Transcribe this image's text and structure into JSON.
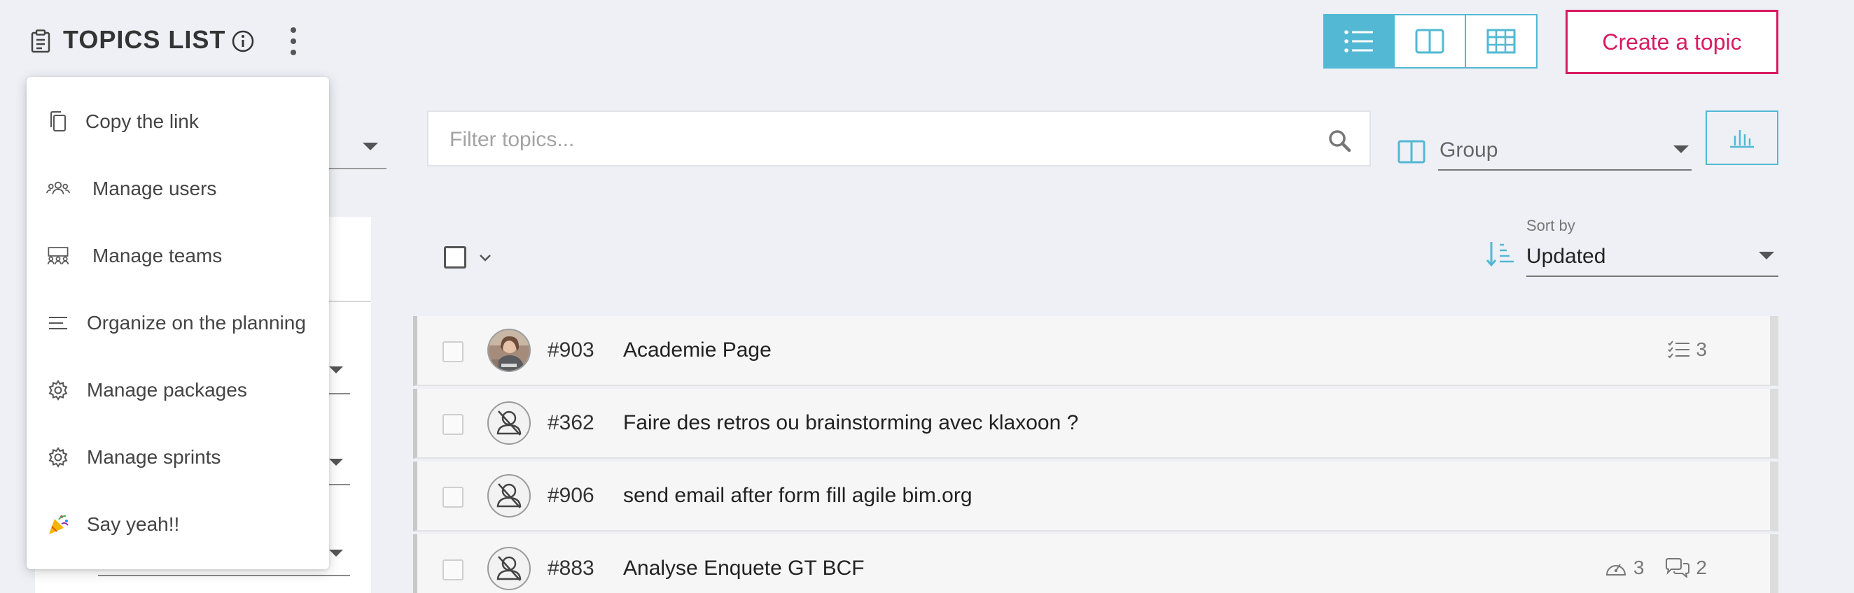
{
  "header": {
    "title": "TOPICS LIST",
    "create_label": "Create a topic"
  },
  "filter": {
    "placeholder": "Filter topics..."
  },
  "group": {
    "value": "Group"
  },
  "sort": {
    "label": "Sort by",
    "value": "Updated"
  },
  "menu": {
    "items": [
      {
        "label": "Copy the link",
        "icon": "copy-icon"
      },
      {
        "label": "Manage users",
        "icon": "users-icon"
      },
      {
        "label": "Manage teams",
        "icon": "teams-icon"
      },
      {
        "label": "Organize on the planning",
        "icon": "lines-icon"
      },
      {
        "label": "Manage packages",
        "icon": "gear-icon"
      },
      {
        "label": "Manage sprints",
        "icon": "gear-icon"
      },
      {
        "label": "Say yeah!!",
        "icon": "party-icon"
      }
    ]
  },
  "topics": [
    {
      "number": "#903",
      "title": "Academie Page",
      "checklist_count": "3"
    },
    {
      "number": "#362",
      "title": "Faire des retros ou brainstorming avec klaxoon ?"
    },
    {
      "number": "#906",
      "title": "send email after form fill agile bim.org"
    },
    {
      "number": "#883",
      "title": "Analyse Enquete GT BCF",
      "priority_count": "3",
      "comment_count": "2"
    }
  ],
  "colors": {
    "accent": "#52b8d4",
    "create": "#d81b60",
    "background": "#eef0f6"
  }
}
